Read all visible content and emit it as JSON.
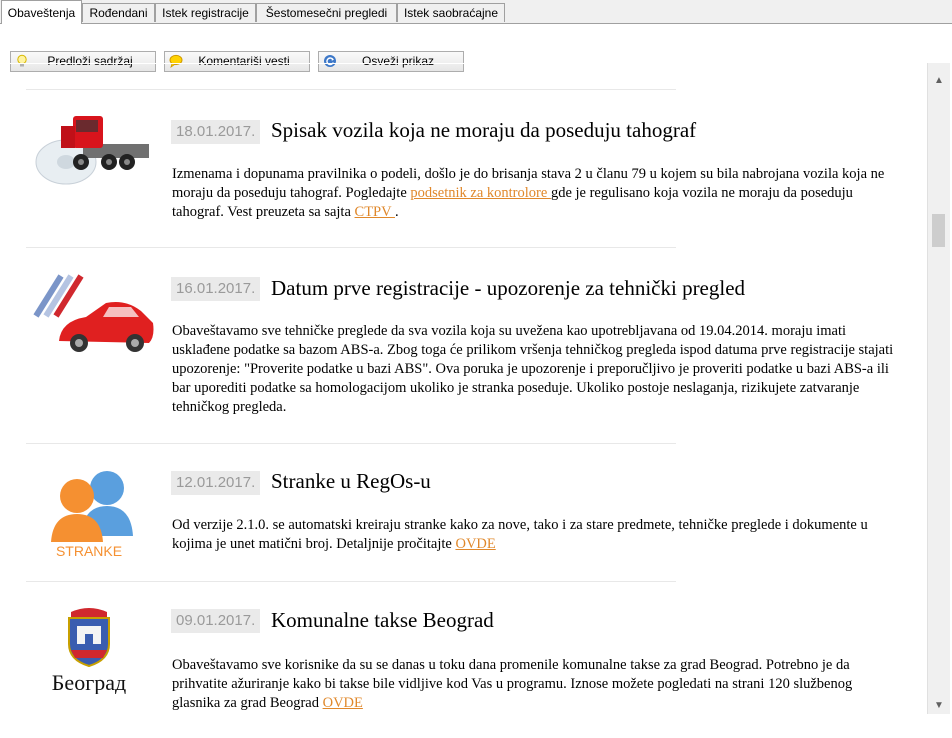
{
  "tabs": [
    {
      "label": "Obaveštenja",
      "active": true
    },
    {
      "label": "Rođendani",
      "active": false
    },
    {
      "label": "Istek registracije",
      "active": false
    },
    {
      "label": "Šestomesečni pregledi",
      "active": false
    },
    {
      "label": "Istek saobraćajne",
      "active": false
    }
  ],
  "toolbar": {
    "submit_label": "Predloži sadržaj",
    "comment_label": "Komentariši vesti",
    "refresh_label": "Osveži prikaz"
  },
  "news": [
    {
      "date": "18.01.2017.",
      "title": "Spisak vozila koja ne moraju da poseduju tahograf",
      "text_a": "Izmenama i dopunama pravilnika o podeli, došlo je do brisanja stava 2 u članu 79 u kojem su bila nabrojana vozila koja ne moraju da poseduju tahograf. Pogledajte ",
      "link_a": "podsetnik za kontrolore ",
      "text_b": "gde je regulisano koja vozila ne moraju da poseduju tahograf. Vest preuzeta sa sajta ",
      "link_b": "CTPV ",
      "text_c": "."
    },
    {
      "date": "16.01.2017.",
      "title": "Datum prve registracije - upozorenje za tehnički pregled",
      "text_a": "Obaveštavamo sve tehničke preglede da sva vozila koja su uvežena kao upotrebljavana od 19.04.2014. moraju imati usklađene podatke sa bazom ABS-a. Zbog toga će prilikom vršenja tehničkog pregleda ispod datuma prve registracije stajati upozorenje: \"Proverite podatke u bazi ABS\". Ova poruka je upozorenje i preporučljivo je proveriti podatke u bazi ABS-a ili bar uporediti podatke sa homologacijom ukoliko je stranka poseduje. Ukoliko postoje neslaganja, rizikujete zatvaranje tehničkog pregleda."
    },
    {
      "date": "12.01.2017.",
      "title": "Stranke u RegOs-u",
      "text_a": "Od verzije 2.1.0. se automatski kreiraju stranke kako za nove, tako i za stare predmete, tehničke preglede i dokumente u kojima je unet matični broj. Detaljnije pročitajte ",
      "link_a": "OVDE",
      "image_label": "STRANKE"
    },
    {
      "date": "09.01.2017.",
      "title": "Komunalne takse Beograd",
      "text_a": "Obaveštavamo sve korisnike da su se danas u toku dana promenile komunalne takse za grad Beograd. Potrebno je da prihvatite ažuriranje kako bi takse bile vidljive kod Vas u programu. Iznose možete pogledati na strani 120 službenog glasnika za grad Beograd ",
      "link_a": "OVDE",
      "image_label": "Београд"
    }
  ],
  "colors": {
    "link": "#e0882b",
    "date_bg": "#eaeaea",
    "date_text": "#9a9a9a"
  }
}
